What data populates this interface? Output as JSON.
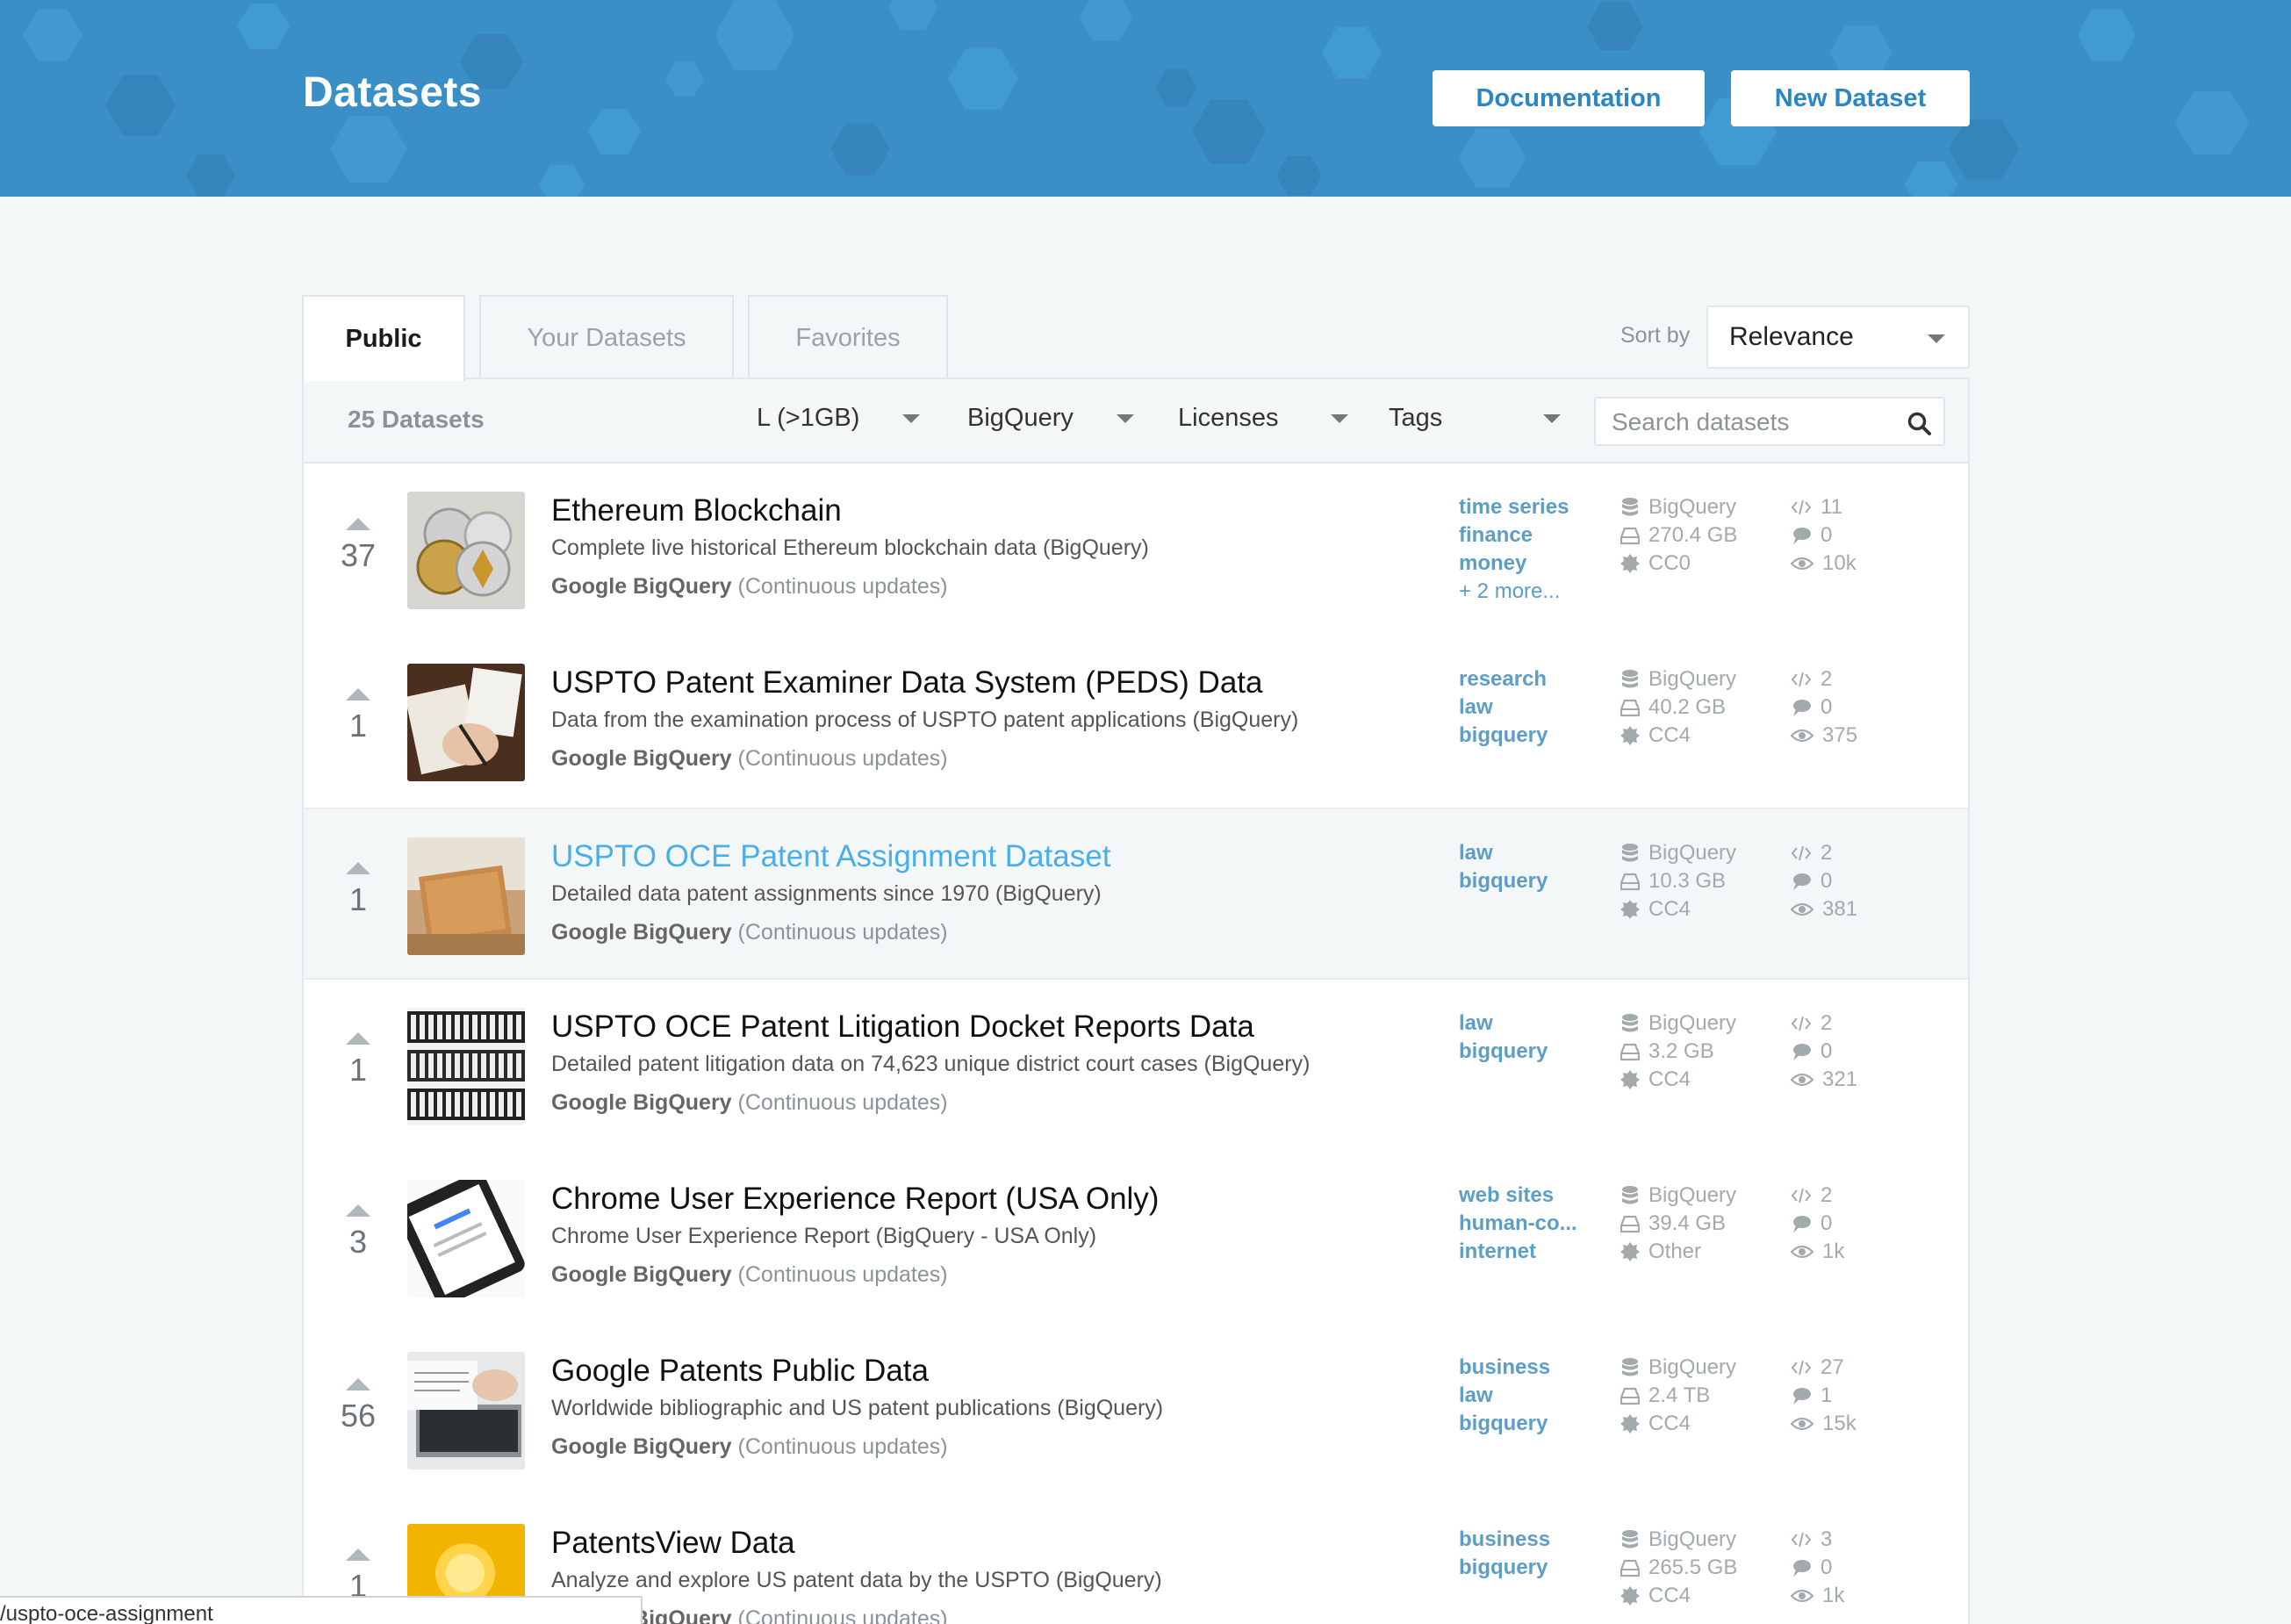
{
  "header": {
    "title": "Datasets",
    "documentation_label": "Documentation",
    "new_dataset_label": "New Dataset",
    "background_color": "#3a8fc7"
  },
  "tabs": [
    {
      "label": "Public",
      "active": true
    },
    {
      "label": "Your Datasets",
      "active": false
    },
    {
      "label": "Favorites",
      "active": false
    }
  ],
  "sort": {
    "label": "Sort by",
    "value": "Relevance"
  },
  "filters": {
    "count": "25 Datasets",
    "size": "L (>1GB)",
    "type": "BigQuery",
    "licenses": "Licenses",
    "tags": "Tags",
    "search_placeholder": "Search datasets"
  },
  "datasets": [
    {
      "votes": "37",
      "title": "Ethereum Blockchain",
      "description": "Complete live historical Ethereum blockchain data (BigQuery)",
      "owner": "Google BigQuery",
      "update": "(Continuous updates)",
      "tags": [
        "time series",
        "finance",
        "money"
      ],
      "more_tags": "+ 2 more...",
      "source": "BigQuery",
      "size": "270.4 GB",
      "license": "CC0",
      "kernels": "11",
      "comments": "0",
      "views": "10k",
      "thumb": "coins"
    },
    {
      "votes": "1",
      "title": "USPTO Patent Examiner Data System (PEDS) Data",
      "description": "Data from the examination process of USPTO patent applications (BigQuery)",
      "owner": "Google BigQuery",
      "update": "(Continuous updates)",
      "tags": [
        "research",
        "law",
        "bigquery"
      ],
      "source": "BigQuery",
      "size": "40.2 GB",
      "license": "CC4",
      "kernels": "2",
      "comments": "0",
      "views": "375",
      "thumb": "writing"
    },
    {
      "votes": "1",
      "title": "USPTO OCE Patent Assignment Dataset",
      "description": "Detailed data patent assignments since 1970 (BigQuery)",
      "owner": "Google BigQuery",
      "update": "(Continuous updates)",
      "tags": [
        "law",
        "bigquery"
      ],
      "source": "BigQuery",
      "size": "10.3 GB",
      "license": "CC4",
      "kernels": "2",
      "comments": "0",
      "views": "381",
      "thumb": "folder"
    },
    {
      "votes": "1",
      "title": "USPTO OCE Patent Litigation Docket Reports Data",
      "description": "Detailed patent litigation data on 74,623 unique district court cases (BigQuery)",
      "owner": "Google BigQuery",
      "update": "(Continuous updates)",
      "tags": [
        "law",
        "bigquery"
      ],
      "source": "BigQuery",
      "size": "3.2 GB",
      "license": "CC4",
      "kernels": "2",
      "comments": "0",
      "views": "321",
      "thumb": "binders"
    },
    {
      "votes": "3",
      "title": "Chrome User Experience Report (USA Only)",
      "description": "Chrome User Experience Report (BigQuery - USA Only)",
      "owner": "Google BigQuery",
      "update": "(Continuous updates)",
      "tags": [
        "web sites",
        "human-co...",
        "internet"
      ],
      "source": "BigQuery",
      "size": "39.4 GB",
      "license": "Other",
      "kernels": "2",
      "comments": "0",
      "views": "1k",
      "thumb": "phone"
    },
    {
      "votes": "56",
      "title": "Google Patents Public Data",
      "description": "Worldwide bibliographic and US patent publications (BigQuery)",
      "owner": "Google BigQuery",
      "update": "(Continuous updates)",
      "tags": [
        "business",
        "law",
        "bigquery"
      ],
      "source": "BigQuery",
      "size": "2.4 TB",
      "license": "CC4",
      "kernels": "27",
      "comments": "1",
      "views": "15k",
      "thumb": "laptop"
    },
    {
      "votes": "1",
      "title": "PatentsView Data",
      "description": "Analyze and explore US patent data by the USPTO (BigQuery)",
      "owner": "Google BigQuery",
      "update": "(Continuous updates)",
      "tags": [
        "business",
        "bigquery"
      ],
      "source": "BigQuery",
      "size": "265.5 GB",
      "license": "CC4",
      "kernels": "3",
      "comments": "0",
      "views": "1k",
      "thumb": "bulb"
    }
  ],
  "statusbar": {
    "url": "/uspto-oce-assignment"
  }
}
